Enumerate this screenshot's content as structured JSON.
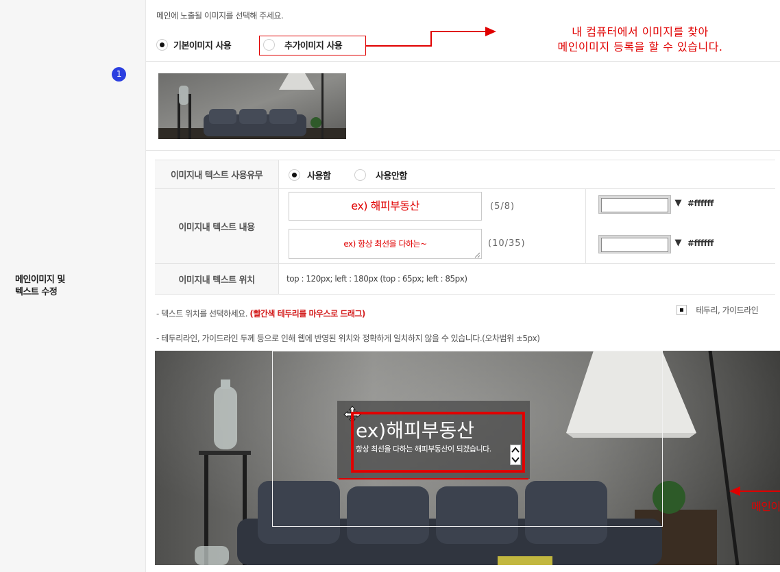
{
  "section": {
    "label_line1": "메인이미지 및",
    "label_line2": "텍스트 수정",
    "step_number": "1"
  },
  "image_choice": {
    "hint": "메인에 노출될 이미지를 선택해 주세요.",
    "options": [
      {
        "label": "기본이미지 사용",
        "selected": true
      },
      {
        "label": "추가이미지 사용",
        "selected": false
      }
    ],
    "callout_line1": "내 컴퓨터에서 이미지를 찾아",
    "callout_line2": "메인이미지 등록을 할 수 있습니다."
  },
  "text_settings": {
    "use_label": "이미지내 텍스트 사용유무",
    "use_options": [
      {
        "label": "사용함",
        "selected": true
      },
      {
        "label": "사용안함",
        "selected": false
      }
    ],
    "content_label": "이미지내 텍스트 내용",
    "title_value": "ex) 해피부동산",
    "title_count": "(5/8)",
    "title_color": "#ffffff",
    "sub_value": "ex) 항상 최선을 다하는~",
    "sub_count": "(10/35)",
    "sub_color": "#ffffff",
    "position_label": "이미지내 텍스트 위치",
    "position_value": "top : 120px; left : 180px (top : 65px; left : 85px)"
  },
  "notes": {
    "drag_prefix": "- 텍스트 위치를 선택하세요. ",
    "drag_emphasis": "(빨간색 테두리를 마우스로 드래그)",
    "guide_checkbox_label": "테두리, 가이드라인",
    "guide_checked": true,
    "warning": "- 테두리라인, 가이드라인 두께 등으로 인해 웹에 반영된 위치와 정확하게 일치하지 않을 수 있습니다.(오차범위 ±5px)"
  },
  "preview": {
    "title": "ex)해피부동산",
    "subtitle": "항상 최선을 다하는 해피부동산이 되겠습니다.",
    "side_callout": "메인이"
  },
  "colors": {
    "accent_red": "#e00000",
    "badge_blue": "#2b3fe0"
  }
}
